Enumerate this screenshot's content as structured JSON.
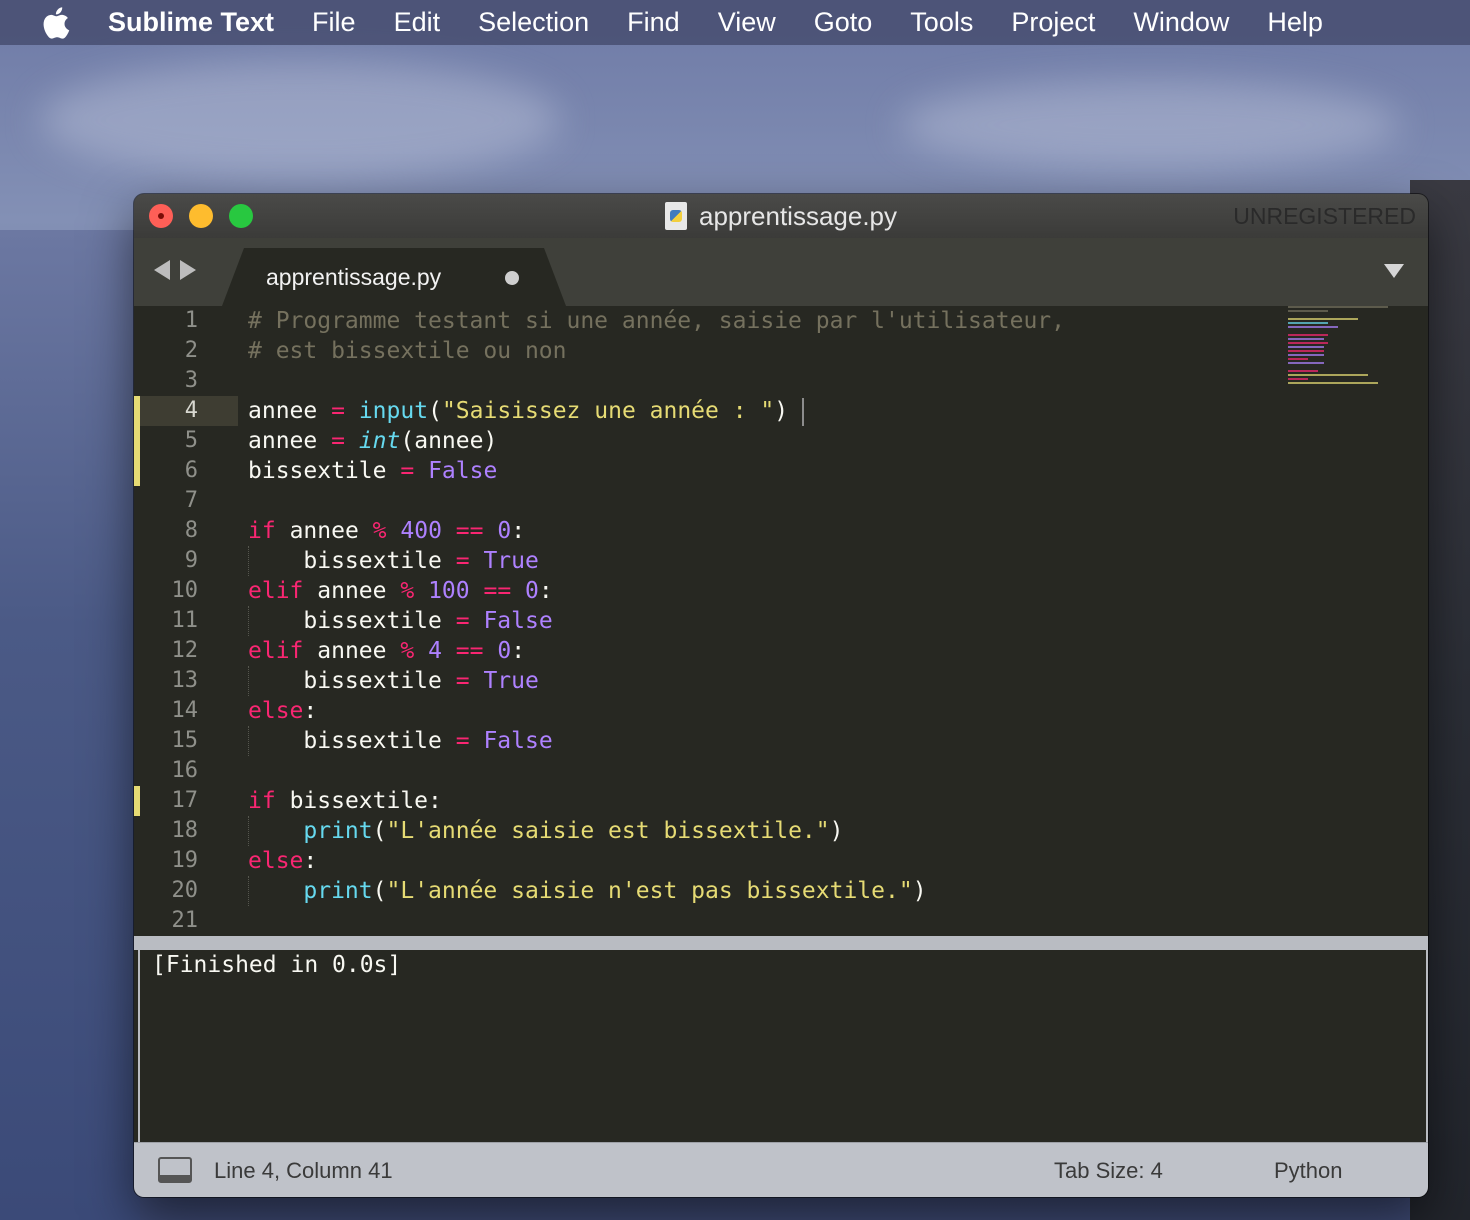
{
  "menubar": {
    "app": "Sublime Text",
    "items": [
      "File",
      "Edit",
      "Selection",
      "Find",
      "View",
      "Goto",
      "Tools",
      "Project",
      "Window",
      "Help"
    ]
  },
  "window": {
    "title": "apprentissage.py",
    "badge": "UNREGISTERED",
    "tab_label": "apprentissage.py"
  },
  "editor": {
    "line_numbers": [
      "1",
      "2",
      "3",
      "4",
      "5",
      "6",
      "7",
      "8",
      "9",
      "10",
      "11",
      "12",
      "13",
      "14",
      "15",
      "16",
      "17",
      "18",
      "19",
      "20",
      "21"
    ],
    "lines": {
      "l1": "# Programme testant si une année, saisie par l'utilisateur,",
      "l2": "# est bissextile ou non",
      "l4_var": "annee",
      "l4_op": "=",
      "l4_fn": "input",
      "l4_p1": "(",
      "l4_str": "\"Saisissez une année : \"",
      "l4_p2": ")",
      "l5_var": "annee",
      "l5_op": "=",
      "l5_fn": "int",
      "l5_rest": "(annee)",
      "l6_var": "bissextile",
      "l6_op": "=",
      "l6_val": "False",
      "l8_kw": "if",
      "l8_var": "annee",
      "l8_mod": "%",
      "l8_n1": "400",
      "l8_eq": "==",
      "l8_n2": "0",
      "l8_colon": ":",
      "l9_var": "bissextile",
      "l9_op": "=",
      "l9_val": "True",
      "l10_kw": "elif",
      "l10_var": "annee",
      "l10_mod": "%",
      "l10_n1": "100",
      "l10_eq": "==",
      "l10_n2": "0",
      "l10_colon": ":",
      "l11_var": "bissextile",
      "l11_op": "=",
      "l11_val": "False",
      "l12_kw": "elif",
      "l12_var": "annee",
      "l12_mod": "%",
      "l12_n1": "4",
      "l12_eq": "==",
      "l12_n2": "0",
      "l12_colon": ":",
      "l13_var": "bissextile",
      "l13_op": "=",
      "l13_val": "True",
      "l14_kw": "else",
      "l14_colon": ":",
      "l15_var": "bissextile",
      "l15_op": "=",
      "l15_val": "False",
      "l17_kw": "if",
      "l17_rest": "bissextile:",
      "l18_fn": "print",
      "l18_p1": "(",
      "l18_str": "\"L'année saisie est bissextile.\"",
      "l18_p2": ")",
      "l19_kw": "else",
      "l19_colon": ":",
      "l20_fn": "print",
      "l20_p1": "(",
      "l20_str": "\"L'année saisie n'est pas bissextile.\"",
      "l20_p2": ")"
    }
  },
  "output": {
    "text": "[Finished in 0.0s]"
  },
  "statusbar": {
    "position": "Line 4, Column 41",
    "tab_size": "Tab Size: 4",
    "syntax": "Python"
  },
  "colors": {
    "background": "#272822",
    "comment": "#75715e",
    "keyword": "#f92672",
    "number": "#ae81ff",
    "string": "#e6db74",
    "function": "#66d9ef"
  }
}
